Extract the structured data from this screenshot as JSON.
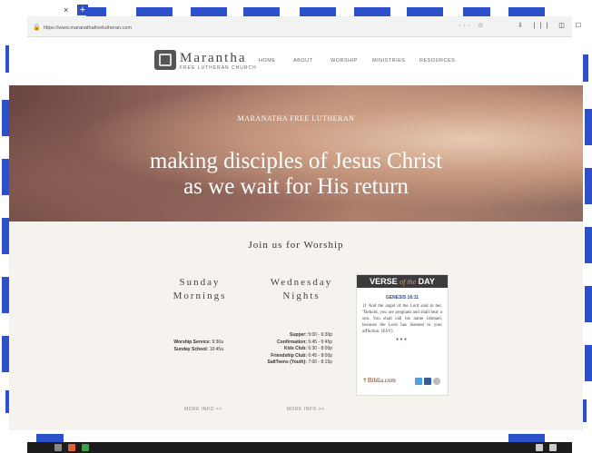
{
  "browser": {
    "url": "https://www.maranathafreelutheran.com",
    "tab_close": "×",
    "tab_new": "+"
  },
  "nav": {
    "brand": "Marantha",
    "brand_sub": "FREE LUTHERAN CHURCH",
    "items": [
      "HOME",
      "ABOUT",
      "WORSHIP",
      "MINISTRIES",
      "RESOURCES"
    ]
  },
  "hero": {
    "subtitle": "MARANATHA FREE LUTHERAN",
    "title_line1": "making disciples of Jesus Christ",
    "title_line2": "as we wait for His return"
  },
  "worship": {
    "heading": "Join us for Worship",
    "sunday": {
      "title_line1": "Sunday",
      "title_line2": "Mornings",
      "rows": [
        {
          "label": "Worship Service:",
          "value": "9:30a"
        },
        {
          "label": "Sunday School:",
          "value": "10:45a"
        }
      ],
      "more": "MORE INFO >>"
    },
    "wednesday": {
      "title_line1": "Wednesday",
      "title_line2": "Nights",
      "rows": [
        {
          "label": "Supper:",
          "value": "5:00 - 6:30p"
        },
        {
          "label": "Confirmation:",
          "value": "5:45 - 6:45p"
        },
        {
          "label": "Kids Club:",
          "value": "6:30 - 8:00p"
        },
        {
          "label": "Friendship Club:",
          "value": "6:45 - 8:00p"
        },
        {
          "label": "SaltTeens (Youth):",
          "value": "7:00 - 8:15p"
        }
      ],
      "more": "MORE INFO >>"
    }
  },
  "votd": {
    "title_a": "VERSE",
    "title_b": "of the",
    "title_c": "DAY",
    "reference": "GENESIS 16:11",
    "text": "11 And the angel of the Lord said to her, \"Behold, you are pregnant and shall bear a son. You shall call his name Ishmael, because the Lord has listened to your affliction. (ESV)",
    "dots": "•••",
    "source": "Biblia.com"
  },
  "colors": {
    "accent": "#2b50c9",
    "hero_text": "#ffffff",
    "content_bg": "#f6f3ee"
  }
}
